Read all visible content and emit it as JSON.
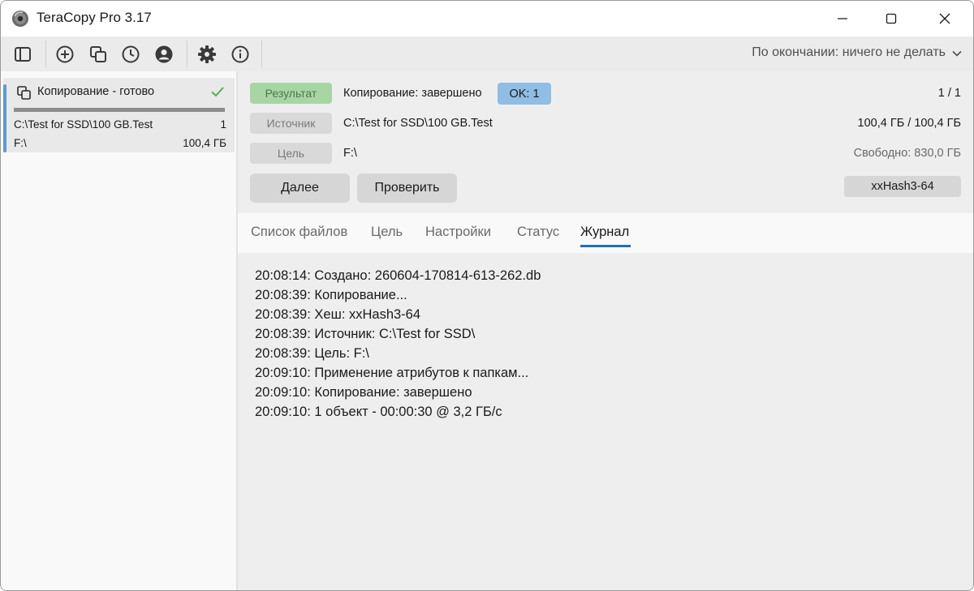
{
  "window": {
    "title": "TeraCopy Pro 3.17"
  },
  "toolbar": {
    "icons": [
      "panel-icon",
      "add-icon",
      "copy-icon",
      "history-icon",
      "user-icon",
      "gear-icon",
      "info-icon"
    ],
    "on_finish_label": "По окончании: ничего не делать"
  },
  "job": {
    "title": "Копирование - готово",
    "source": "C:\\Test for SSD\\100 GB.Test",
    "count": "1",
    "target": "F:\\",
    "size": "100,4 ГБ",
    "progress": 1.0,
    "status_color": "#4caf50"
  },
  "info": {
    "result_label": "Результат",
    "result_text": "Копирование: завершено",
    "ok_badge": "OK: 1",
    "counter": "1 / 1",
    "source_label": "Источник",
    "source_path": "C:\\Test for SSD\\100 GB.Test",
    "source_size": "100,4 ГБ / 100,4 ГБ",
    "target_label": "Цель",
    "target_path": "F:\\",
    "free_space": "Свободно: 830,0 ГБ",
    "next_button": "Далее",
    "verify_button": "Проверить",
    "hash_algorithm": "xxHash3-64"
  },
  "tabs": [
    {
      "label": "Список файлов",
      "active": false
    },
    {
      "label": "Цель",
      "active": false
    },
    {
      "label": "Настройки",
      "active": false
    },
    {
      "label": "Статус",
      "active": false
    },
    {
      "label": "Журнал",
      "active": true
    }
  ],
  "log": [
    "20:08:14: Создано: 260604-170814-613-262.db",
    "20:08:39: Копирование...",
    "20:08:39: Хеш: xxHash3-64",
    "20:08:39: Источник: C:\\Test for SSD\\",
    "20:08:39: Цель: F:\\",
    "20:09:10: Применение атрибутов к папкам...",
    "20:09:10: Копирование: завершено",
    "20:09:10: 1 объект - 00:00:30 @ 3,2 ГБ/с"
  ],
  "colors": {
    "accent": "#1f6fc0",
    "result_green": "#a8d5a4",
    "ok_blue": "#8fbde4"
  }
}
